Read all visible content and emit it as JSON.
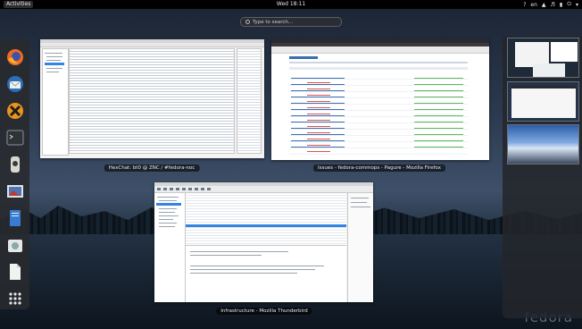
{
  "topbar": {
    "activities": "Activities",
    "clock": "Wed 18:11",
    "keyboard_layout": "en",
    "icons": [
      "help-icon",
      "keyboard-icon",
      "network-icon",
      "volume-icon",
      "battery-icon",
      "power-icon",
      "menu-arrow-icon"
    ]
  },
  "search": {
    "placeholder": "Type to search..."
  },
  "dash": {
    "apps": [
      "firefox-icon",
      "thunderbird-icon",
      "hexchat-icon",
      "terminal-icon",
      "yubikey-icon",
      "image-viewer-icon",
      "document-viewer-icon",
      "software-icon",
      "files-icon",
      "show-apps-icon"
    ]
  },
  "windows": {
    "hexchat": {
      "title": "HexChat: bt0 @ ZNC / #fedora-noc"
    },
    "firefox": {
      "title": "Issues - fedora-commops - Pagure - Mozilla Firefox"
    },
    "thunderbird": {
      "title": "Infrastructure - Mozilla Thunderbird"
    }
  },
  "branding": "fedora"
}
